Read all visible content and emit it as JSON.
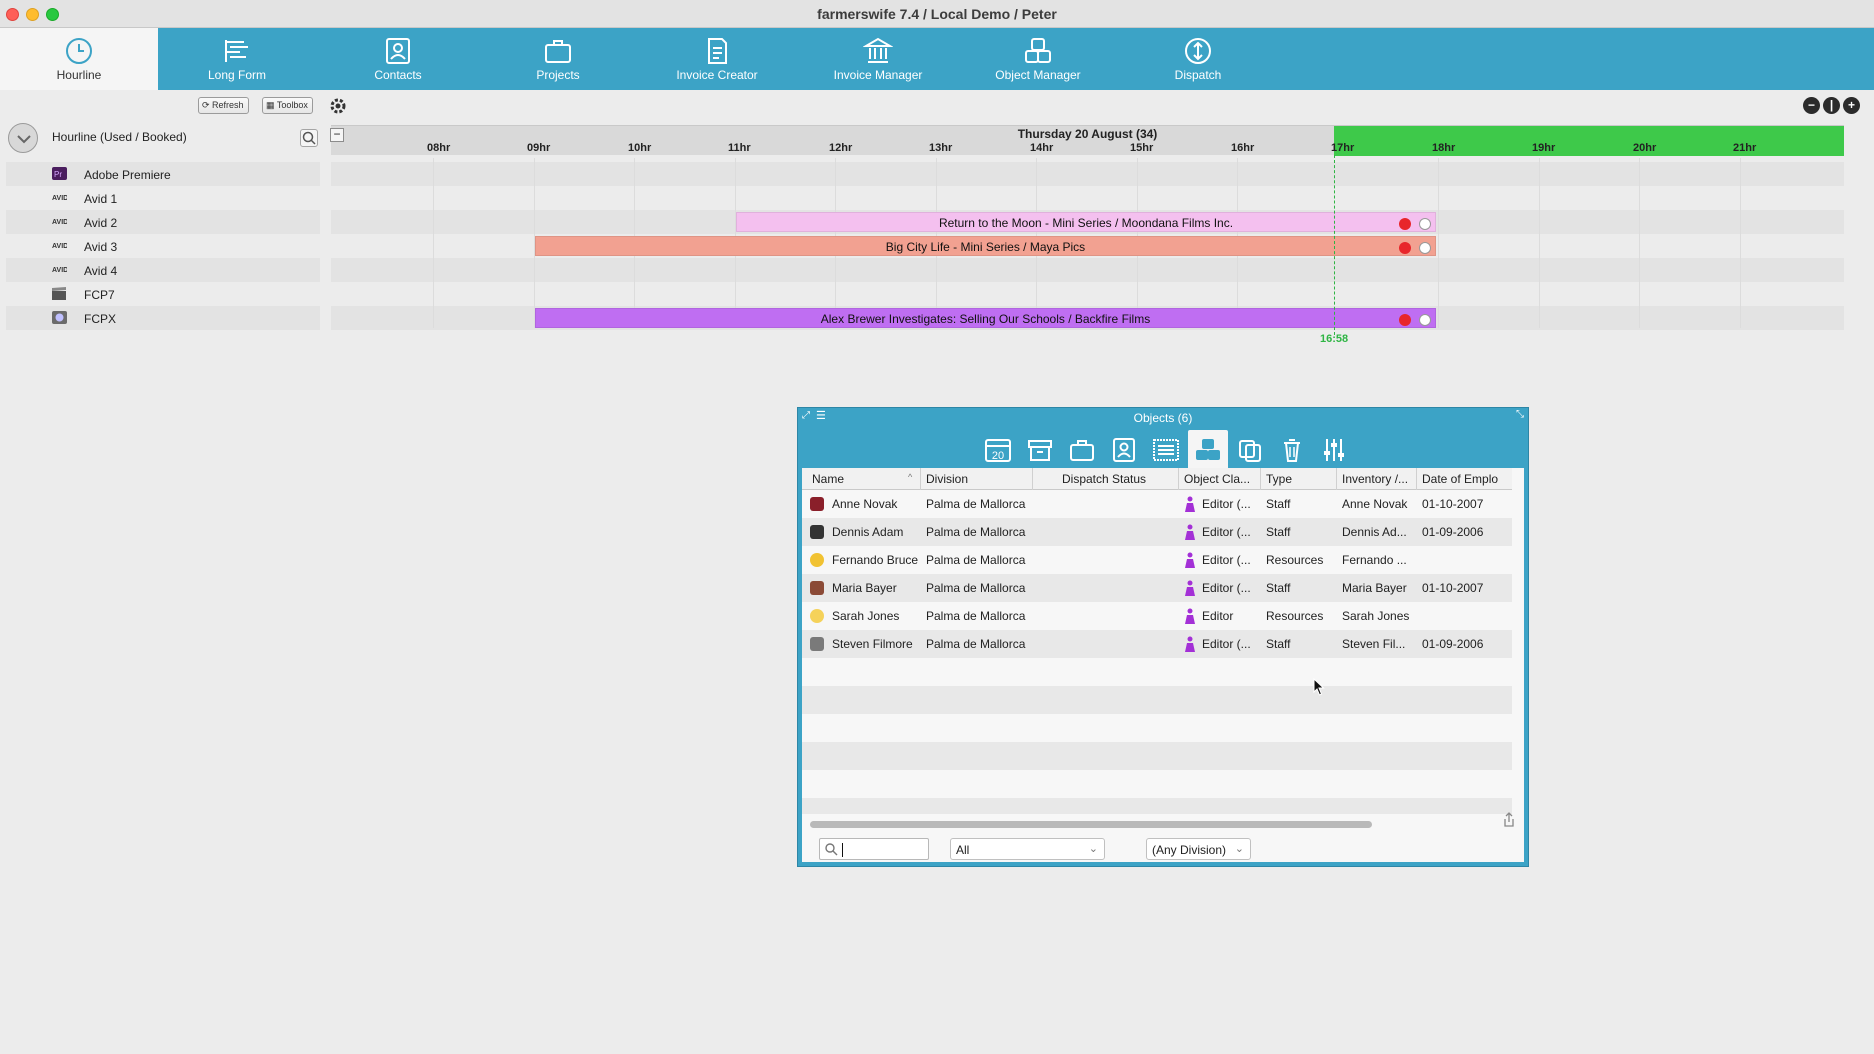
{
  "window": {
    "title": "farmerswife 7.4  / Local Demo / Peter"
  },
  "toolbar": {
    "items": [
      {
        "label": "Hourline",
        "icon": "clock-icon"
      },
      {
        "label": "Long Form",
        "icon": "long-form-icon"
      },
      {
        "label": "Contacts",
        "icon": "contacts-icon"
      },
      {
        "label": "Projects",
        "icon": "briefcase-icon"
      },
      {
        "label": "Invoice Creator",
        "icon": "invoice-creator-icon"
      },
      {
        "label": "Invoice Manager",
        "icon": "bank-icon"
      },
      {
        "label": "Object Manager",
        "icon": "object-manager-icon"
      },
      {
        "label": "Dispatch",
        "icon": "dispatch-icon"
      }
    ]
  },
  "subtoolbar": {
    "refresh": "Refresh",
    "toolbox": "Toolbox"
  },
  "resources": {
    "title": "Hourline (Used / Booked)",
    "items": [
      {
        "name": "Adobe Premiere"
      },
      {
        "name": "Avid 1"
      },
      {
        "name": "Avid 2"
      },
      {
        "name": "Avid 3"
      },
      {
        "name": "Avid 4"
      },
      {
        "name": "FCP7"
      },
      {
        "name": "FCPX"
      }
    ]
  },
  "timeline": {
    "date": "Thursday 20 August (34)",
    "hours": [
      "08hr",
      "09hr",
      "10hr",
      "11hr",
      "12hr",
      "13hr",
      "14hr",
      "15hr",
      "16hr",
      "17hr",
      "18hr",
      "19hr",
      "20hr",
      "21hr"
    ],
    "now": "16:58",
    "bookings": [
      {
        "label": "Return to the Moon - Mini Series / Moondana Films Inc.",
        "color": "#f4c0ef"
      },
      {
        "label": "Big City Life - Mini Series / Maya Pics",
        "color": "#f2a191"
      },
      {
        "label": "Alex Brewer Investigates: Selling Our Schools / Backfire Films",
        "color": "#bf6ef2"
      }
    ]
  },
  "objects_panel": {
    "title": "Objects (6)",
    "calendar_day": "20",
    "columns": [
      "Name",
      "Division",
      "Dispatch Status",
      "Object Cla...",
      "Type",
      "Inventory /...",
      "Date of Emplo"
    ],
    "rows": [
      {
        "name": "Anne Novak",
        "division": "Palma de Mallorca",
        "dispatch": "",
        "object_class": "Editor (...",
        "type": "Staff",
        "inventory": "Anne Novak",
        "date": "01-10-2007"
      },
      {
        "name": "Dennis Adam",
        "division": "Palma de Mallorca",
        "dispatch": "",
        "object_class": "Editor (...",
        "type": "Staff",
        "inventory": "Dennis Ad...",
        "date": "01-09-2006"
      },
      {
        "name": "Fernando Bruce",
        "division": "Palma de Mallorca",
        "dispatch": "",
        "object_class": "Editor (...",
        "type": "Resources",
        "inventory": "Fernando ...",
        "date": ""
      },
      {
        "name": "Maria Bayer",
        "division": "Palma de Mallorca",
        "dispatch": "",
        "object_class": "Editor (...",
        "type": "Staff",
        "inventory": "Maria Bayer",
        "date": "01-10-2007"
      },
      {
        "name": "Sarah Jones",
        "division": "Palma de Mallorca",
        "dispatch": "",
        "object_class": "Editor",
        "type": "Resources",
        "inventory": "Sarah Jones",
        "date": ""
      },
      {
        "name": "Steven Filmore",
        "division": "Palma de Mallorca",
        "dispatch": "",
        "object_class": "Editor (...",
        "type": "Staff",
        "inventory": "Steven Fil...",
        "date": "01-09-2006"
      }
    ],
    "filter_type": "All",
    "filter_division": "(Any Division)",
    "search_value": ""
  }
}
